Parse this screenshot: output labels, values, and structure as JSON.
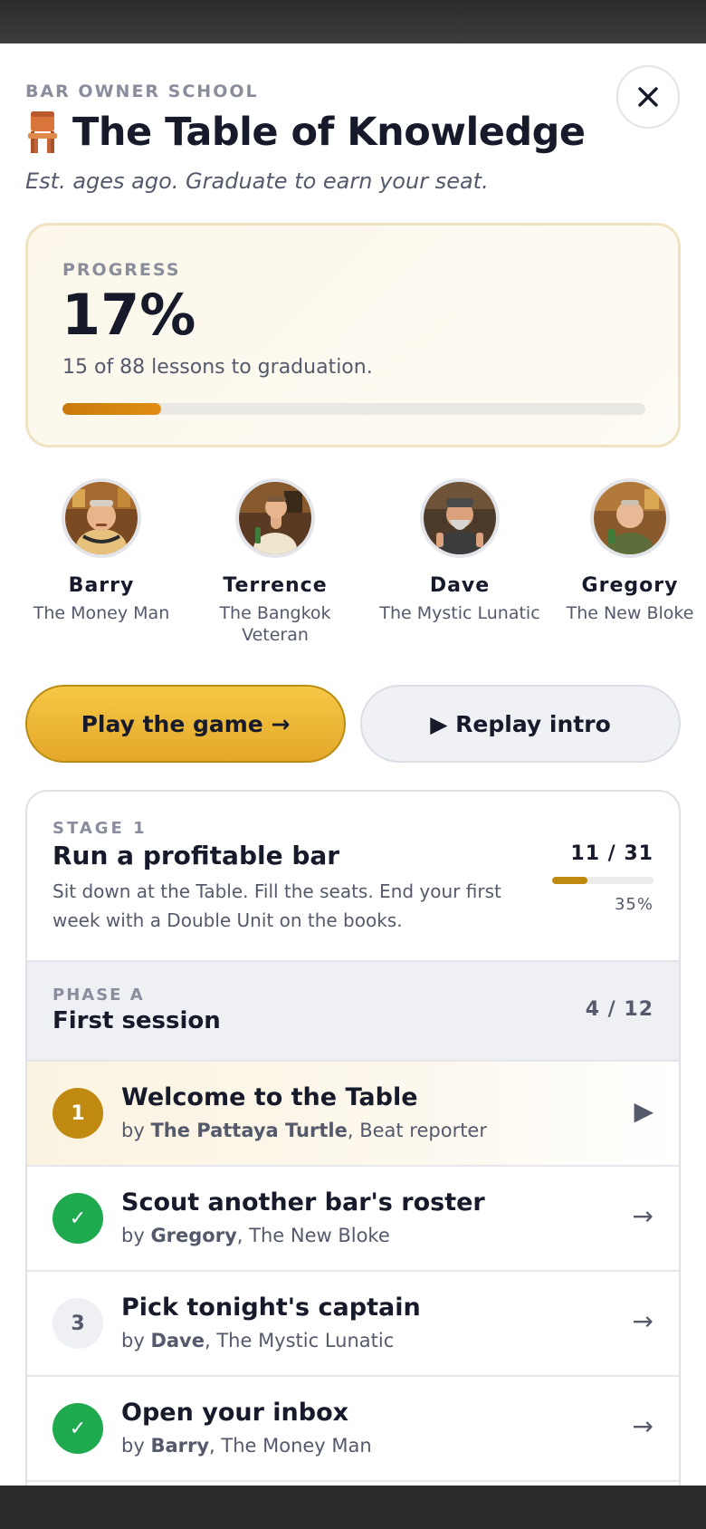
{
  "header": {
    "eyebrow": "BAR OWNER SCHOOL",
    "title": "The Table of Knowledge",
    "subtitle": "Est. ages ago. Graduate to earn your seat.",
    "title_icon": "chair-icon",
    "close_icon": "close-icon"
  },
  "progress": {
    "label": "PROGRESS",
    "percent_text": "17%",
    "percent_value": 17,
    "detail": "15 of 88 lessons to graduation.",
    "accent": "#d4820f"
  },
  "cast": [
    {
      "name": "Barry",
      "role": "The Money Man"
    },
    {
      "name": "Terrence",
      "role": "The Bangkok Veteran"
    },
    {
      "name": "Dave",
      "role": "The Mystic Lunatic"
    },
    {
      "name": "Gregory",
      "role": "The New Bloke"
    }
  ],
  "actions": {
    "play_label": "Play the game →",
    "replay_label": "▶ Replay intro"
  },
  "stage": {
    "eyebrow": "STAGE 1",
    "title": "Run a profitable bar",
    "description": "Sit down at the Table. Fill the seats. End your first week with a Double Unit on the books.",
    "count": "11 / 31",
    "percent_text": "35%",
    "percent_value": 35
  },
  "phase": {
    "eyebrow": "PHASE A",
    "title": "First session",
    "count": "4 / 12"
  },
  "lessons": [
    {
      "number": "1",
      "status": "current",
      "title": "Welcome to the Table",
      "by_prefix": "by ",
      "author": "The Pattaya Turtle",
      "author_role": ", Beat reporter",
      "arrow": "▶"
    },
    {
      "number": "✓",
      "status": "done",
      "title": "Scout another bar's roster",
      "by_prefix": "by ",
      "author": "Gregory",
      "author_role": ", The New Bloke",
      "arrow": "→"
    },
    {
      "number": "3",
      "status": "todo",
      "title": "Pick tonight's captain",
      "by_prefix": "by ",
      "author": "Dave",
      "author_role": ", The Mystic Lunatic",
      "arrow": "→"
    },
    {
      "number": "✓",
      "status": "done",
      "title": "Open your inbox",
      "by_prefix": "by ",
      "author": "Barry",
      "author_role": ", The Money Man",
      "arrow": "→"
    }
  ]
}
